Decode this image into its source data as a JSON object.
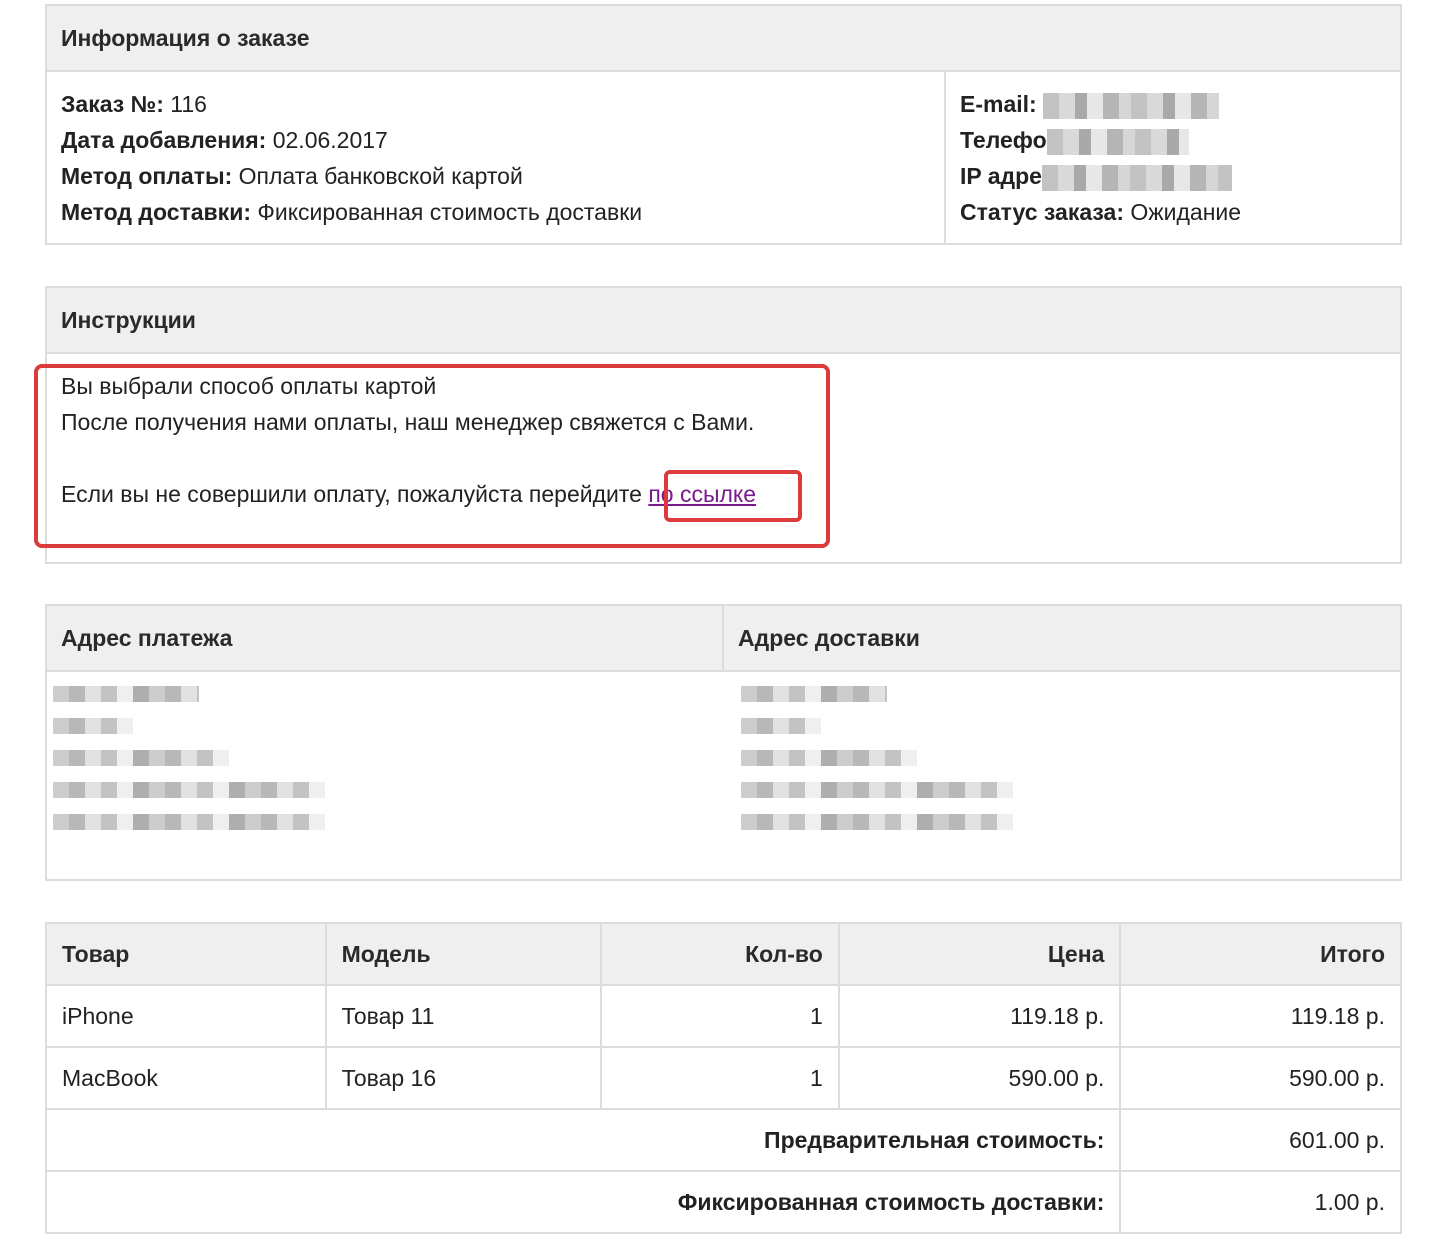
{
  "order_info": {
    "title": "Информация о заказе",
    "left": [
      {
        "label": "Заказ №:",
        "value": "116"
      },
      {
        "label": "Дата добавления:",
        "value": "02.06.2017"
      },
      {
        "label": "Метод оплаты:",
        "value": "Оплата банковской картой"
      },
      {
        "label": "Метод доставки:",
        "value": "Фиксированная стоимость доставки"
      }
    ],
    "right": {
      "email_label": "E-mail:",
      "phone_label": "Телефо",
      "ip_label": "IP адре",
      "status_label": "Статус заказа:",
      "status_value": "Ожидание"
    }
  },
  "instructions": {
    "title": "Инструкции",
    "line1": "Вы выбрали способ оплаты картой",
    "line2": "После получения нами оплаты, наш менеджер свяжется с Вами.",
    "line3_text": "Если вы не совершили оплату, пожалуйста перейдите ",
    "link_text": "по ссылке",
    "highlight_color": "#dc3b3b",
    "link_color": "#7a1a8c"
  },
  "addresses": {
    "payment_title": "Адрес платежа",
    "shipping_title": "Адрес доставки"
  },
  "products": {
    "headers": [
      "Товар",
      "Модель",
      "Кол-во",
      "Цена",
      "Итого"
    ],
    "rows": [
      {
        "name": "iPhone",
        "model": "Товар 11",
        "qty": "1",
        "price": "119.18 р.",
        "total": "119.18 р."
      },
      {
        "name": "MacBook",
        "model": "Товар 16",
        "qty": "1",
        "price": "590.00 р.",
        "total": "590.00 р."
      }
    ],
    "totals": [
      {
        "label": "Предварительная стоимость:",
        "value": "601.00 р."
      },
      {
        "label": "Фиксированная стоимость доставки:",
        "value": "1.00 р."
      }
    ]
  }
}
